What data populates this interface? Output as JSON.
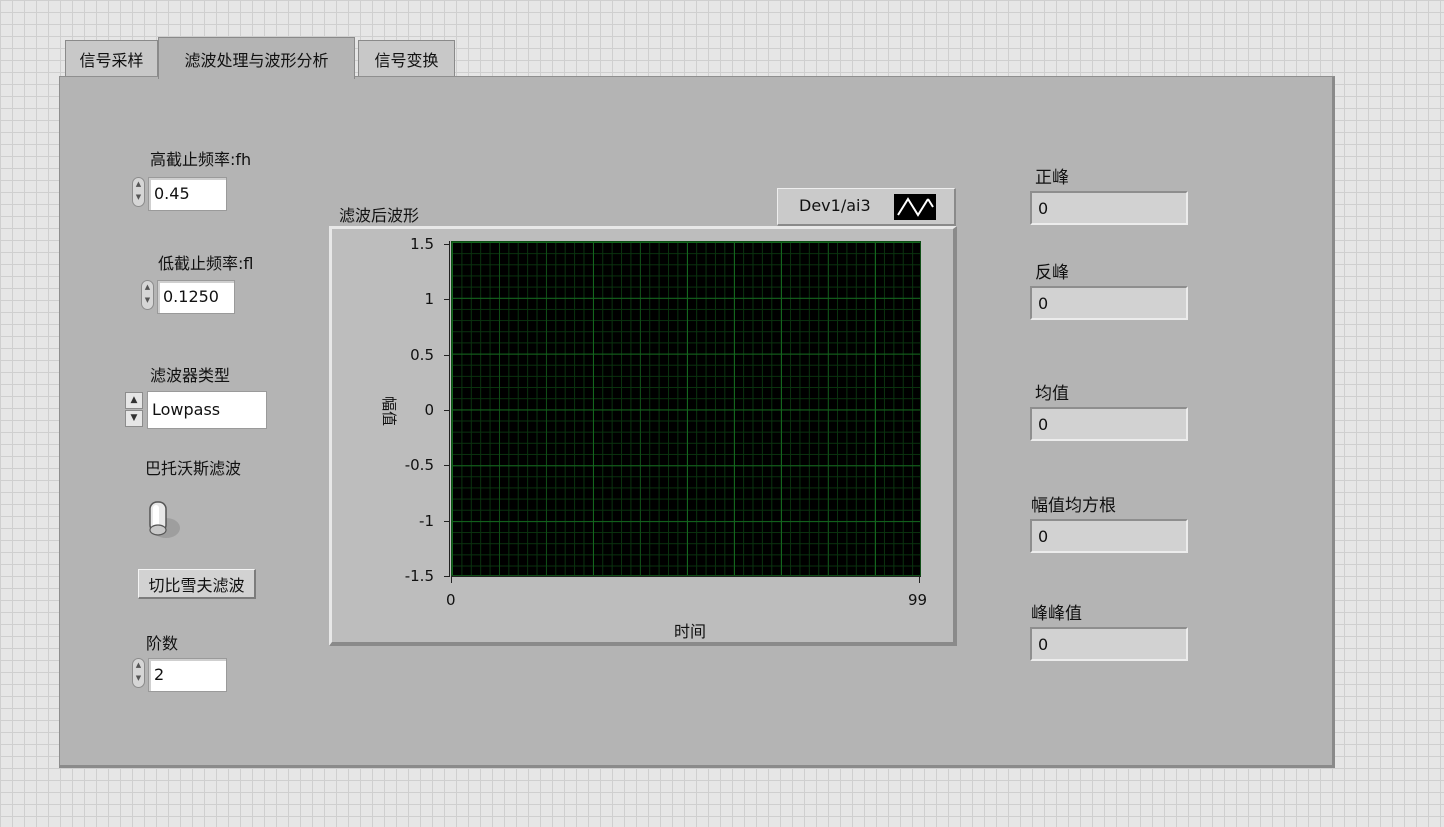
{
  "tabs": [
    {
      "label": "信号采样",
      "active": false
    },
    {
      "label": "滤波处理与波形分析",
      "active": true
    },
    {
      "label": "信号变换",
      "active": false
    }
  ],
  "controls": {
    "fh": {
      "label": "高截止频率:fh",
      "value": "0.45"
    },
    "fl": {
      "label": "低截止频率:fl",
      "value": "0.1250"
    },
    "filter_type": {
      "label": "滤波器类型",
      "value": "Lowpass"
    },
    "butterworth": {
      "label": "巴托沃斯滤波"
    },
    "chebyshev": {
      "label": "切比雪夫滤波"
    },
    "order": {
      "label": "阶数",
      "value": "2"
    }
  },
  "graph": {
    "title": "滤波后波形",
    "legend": "Dev1/ai3",
    "xlabel": "时间",
    "ylabel": "幅值",
    "x_ticks": [
      "0",
      "99"
    ],
    "y_ticks": [
      "1.5",
      "1",
      "0.5",
      "0",
      "-0.5",
      "-1",
      "-1.5"
    ],
    "background": "#000000",
    "grid_color": "#14661e"
  },
  "chart_data": {
    "type": "line",
    "title": "滤波后波形",
    "xlabel": "时间",
    "ylabel": "幅值",
    "xlim": [
      0,
      99
    ],
    "ylim": [
      -1.5,
      1.5
    ],
    "grid": true,
    "series": [
      {
        "name": "Dev1/ai3",
        "values": []
      }
    ]
  },
  "indicators": [
    {
      "label": "正峰",
      "value": "0"
    },
    {
      "label": "反峰",
      "value": "0"
    },
    {
      "label": "均值",
      "value": "0"
    },
    {
      "label": "幅值均方根",
      "value": "0"
    },
    {
      "label": "峰峰值",
      "value": "0"
    }
  ]
}
